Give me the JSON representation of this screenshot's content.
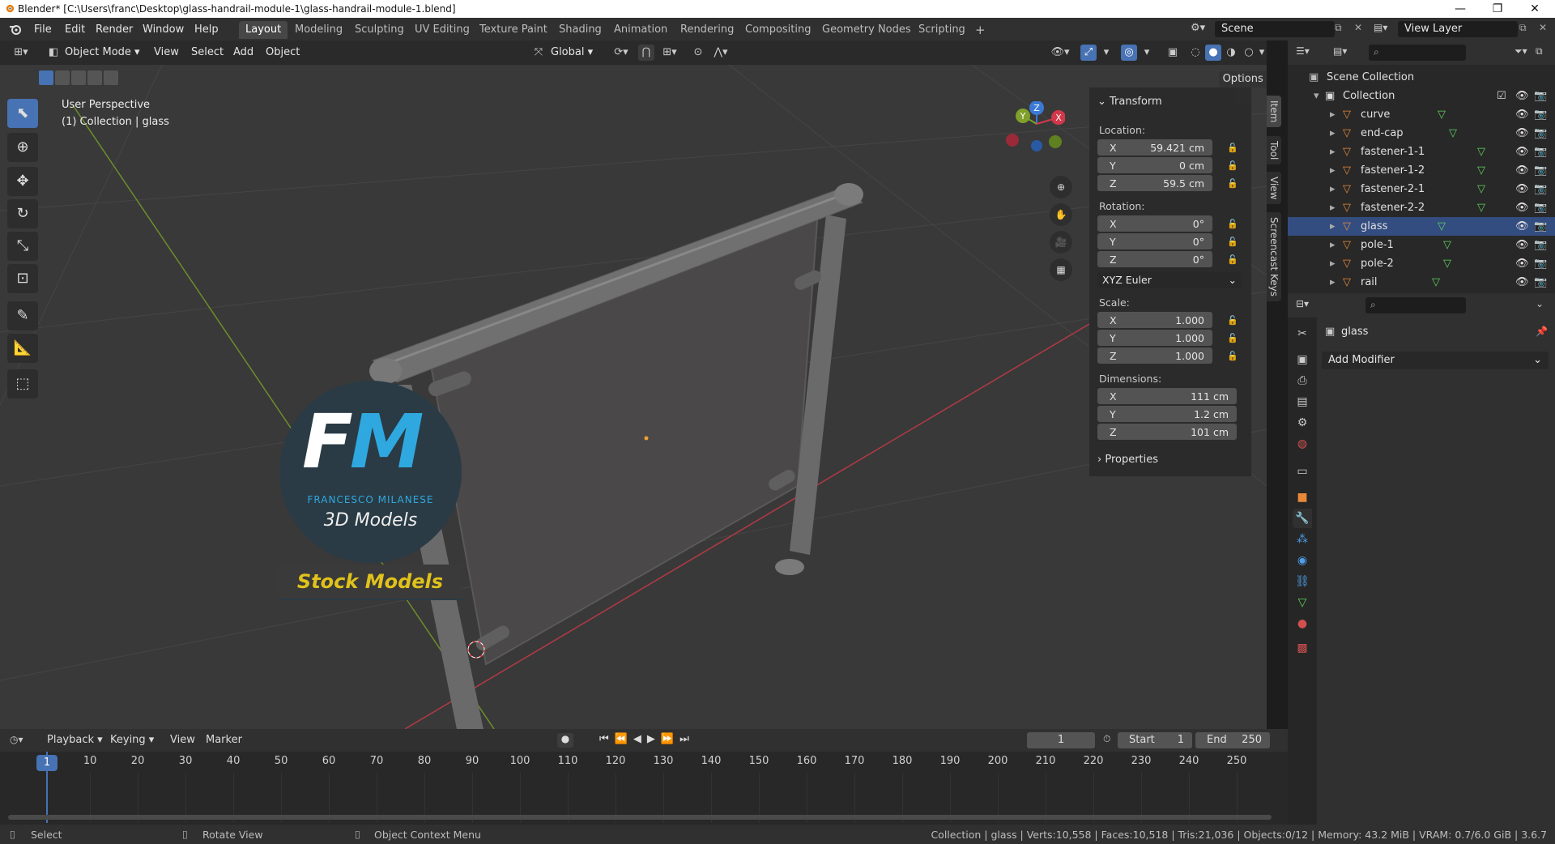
{
  "window": {
    "title": "Blender* [C:\\Users\\franc\\Desktop\\glass-handrail-module-1\\glass-handrail-module-1.blend]",
    "controls": {
      "minimize": "—",
      "maximize": "❐",
      "close": "✕"
    }
  },
  "menu": {
    "items": [
      "File",
      "Edit",
      "Render",
      "Window",
      "Help"
    ],
    "workspaces": [
      "Layout",
      "Modeling",
      "Sculpting",
      "UV Editing",
      "Texture Paint",
      "Shading",
      "Animation",
      "Rendering",
      "Compositing",
      "Geometry Nodes",
      "Scripting"
    ],
    "active_workspace": "Layout",
    "add_tab": "+",
    "scene": "Scene",
    "view_layer": "View Layer"
  },
  "viewport_header": {
    "mode": "Object Mode",
    "menus": [
      "View",
      "Select",
      "Add",
      "Object"
    ],
    "orientation": "Global",
    "options": "Options"
  },
  "viewport": {
    "perspective": "User Perspective",
    "context": "(1) Collection | glass",
    "gizmo_axes": [
      "Z",
      "Y",
      "X"
    ],
    "watermark": {
      "initials": "FM",
      "name": "FRANCESCO MILANESE",
      "subtitle": "3D Models",
      "banner": "Stock Models"
    }
  },
  "side_tabs": [
    "Item",
    "Tool",
    "View",
    "Screencast Keys"
  ],
  "transform_panel": {
    "title": "Transform",
    "location_label": "Location:",
    "location": [
      {
        "axis": "X",
        "value": "59.421 cm"
      },
      {
        "axis": "Y",
        "value": "0 cm"
      },
      {
        "axis": "Z",
        "value": "59.5 cm"
      }
    ],
    "rotation_label": "Rotation:",
    "rotation": [
      {
        "axis": "X",
        "value": "0°"
      },
      {
        "axis": "Y",
        "value": "0°"
      },
      {
        "axis": "Z",
        "value": "0°"
      }
    ],
    "rotation_mode": "XYZ Euler",
    "scale_label": "Scale:",
    "scale": [
      {
        "axis": "X",
        "value": "1.000"
      },
      {
        "axis": "Y",
        "value": "1.000"
      },
      {
        "axis": "Z",
        "value": "1.000"
      }
    ],
    "dimensions_label": "Dimensions:",
    "dimensions": [
      {
        "axis": "X",
        "value": "111 cm"
      },
      {
        "axis": "Y",
        "value": "1.2 cm"
      },
      {
        "axis": "Z",
        "value": "101 cm"
      }
    ],
    "properties_label": "Properties"
  },
  "outliner": {
    "scene_collection": "Scene Collection",
    "collection": "Collection",
    "objects": [
      "curve",
      "end-cap",
      "fastener-1-1",
      "fastener-1-2",
      "fastener-2-1",
      "fastener-2-2",
      "glass",
      "pole-1",
      "pole-2",
      "rail"
    ],
    "selected": "glass"
  },
  "properties": {
    "object_name": "glass",
    "add_modifier": "Add Modifier"
  },
  "timeline": {
    "menus": [
      "Playback",
      "Keying",
      "View",
      "Marker"
    ],
    "current_frame": "1",
    "start_label": "Start",
    "start": "1",
    "end_label": "End",
    "end": "250",
    "ticks": [
      "1",
      "10",
      "20",
      "30",
      "40",
      "50",
      "60",
      "70",
      "80",
      "90",
      "100",
      "110",
      "120",
      "130",
      "140",
      "150",
      "160",
      "170",
      "180",
      "190",
      "200",
      "210",
      "220",
      "230",
      "240",
      "250"
    ]
  },
  "status": {
    "select": "Select",
    "rotate": "Rotate View",
    "context_menu": "Object Context Menu",
    "info": "Collection | glass | Verts:10,558 | Faces:10,518 | Tris:21,036 | Objects:0/12 | Memory: 43.2 MiB | VRAM: 0.7/6.0 GiB | 3.6.7"
  },
  "colors": {
    "accent": "#4772b3",
    "outliner_select": "#334d80",
    "mesh_icon": "#e8893a",
    "data_icon": "#5fd35f",
    "watermark_blue": "#2fa8e0",
    "watermark_yellow": "#e0c21a"
  }
}
